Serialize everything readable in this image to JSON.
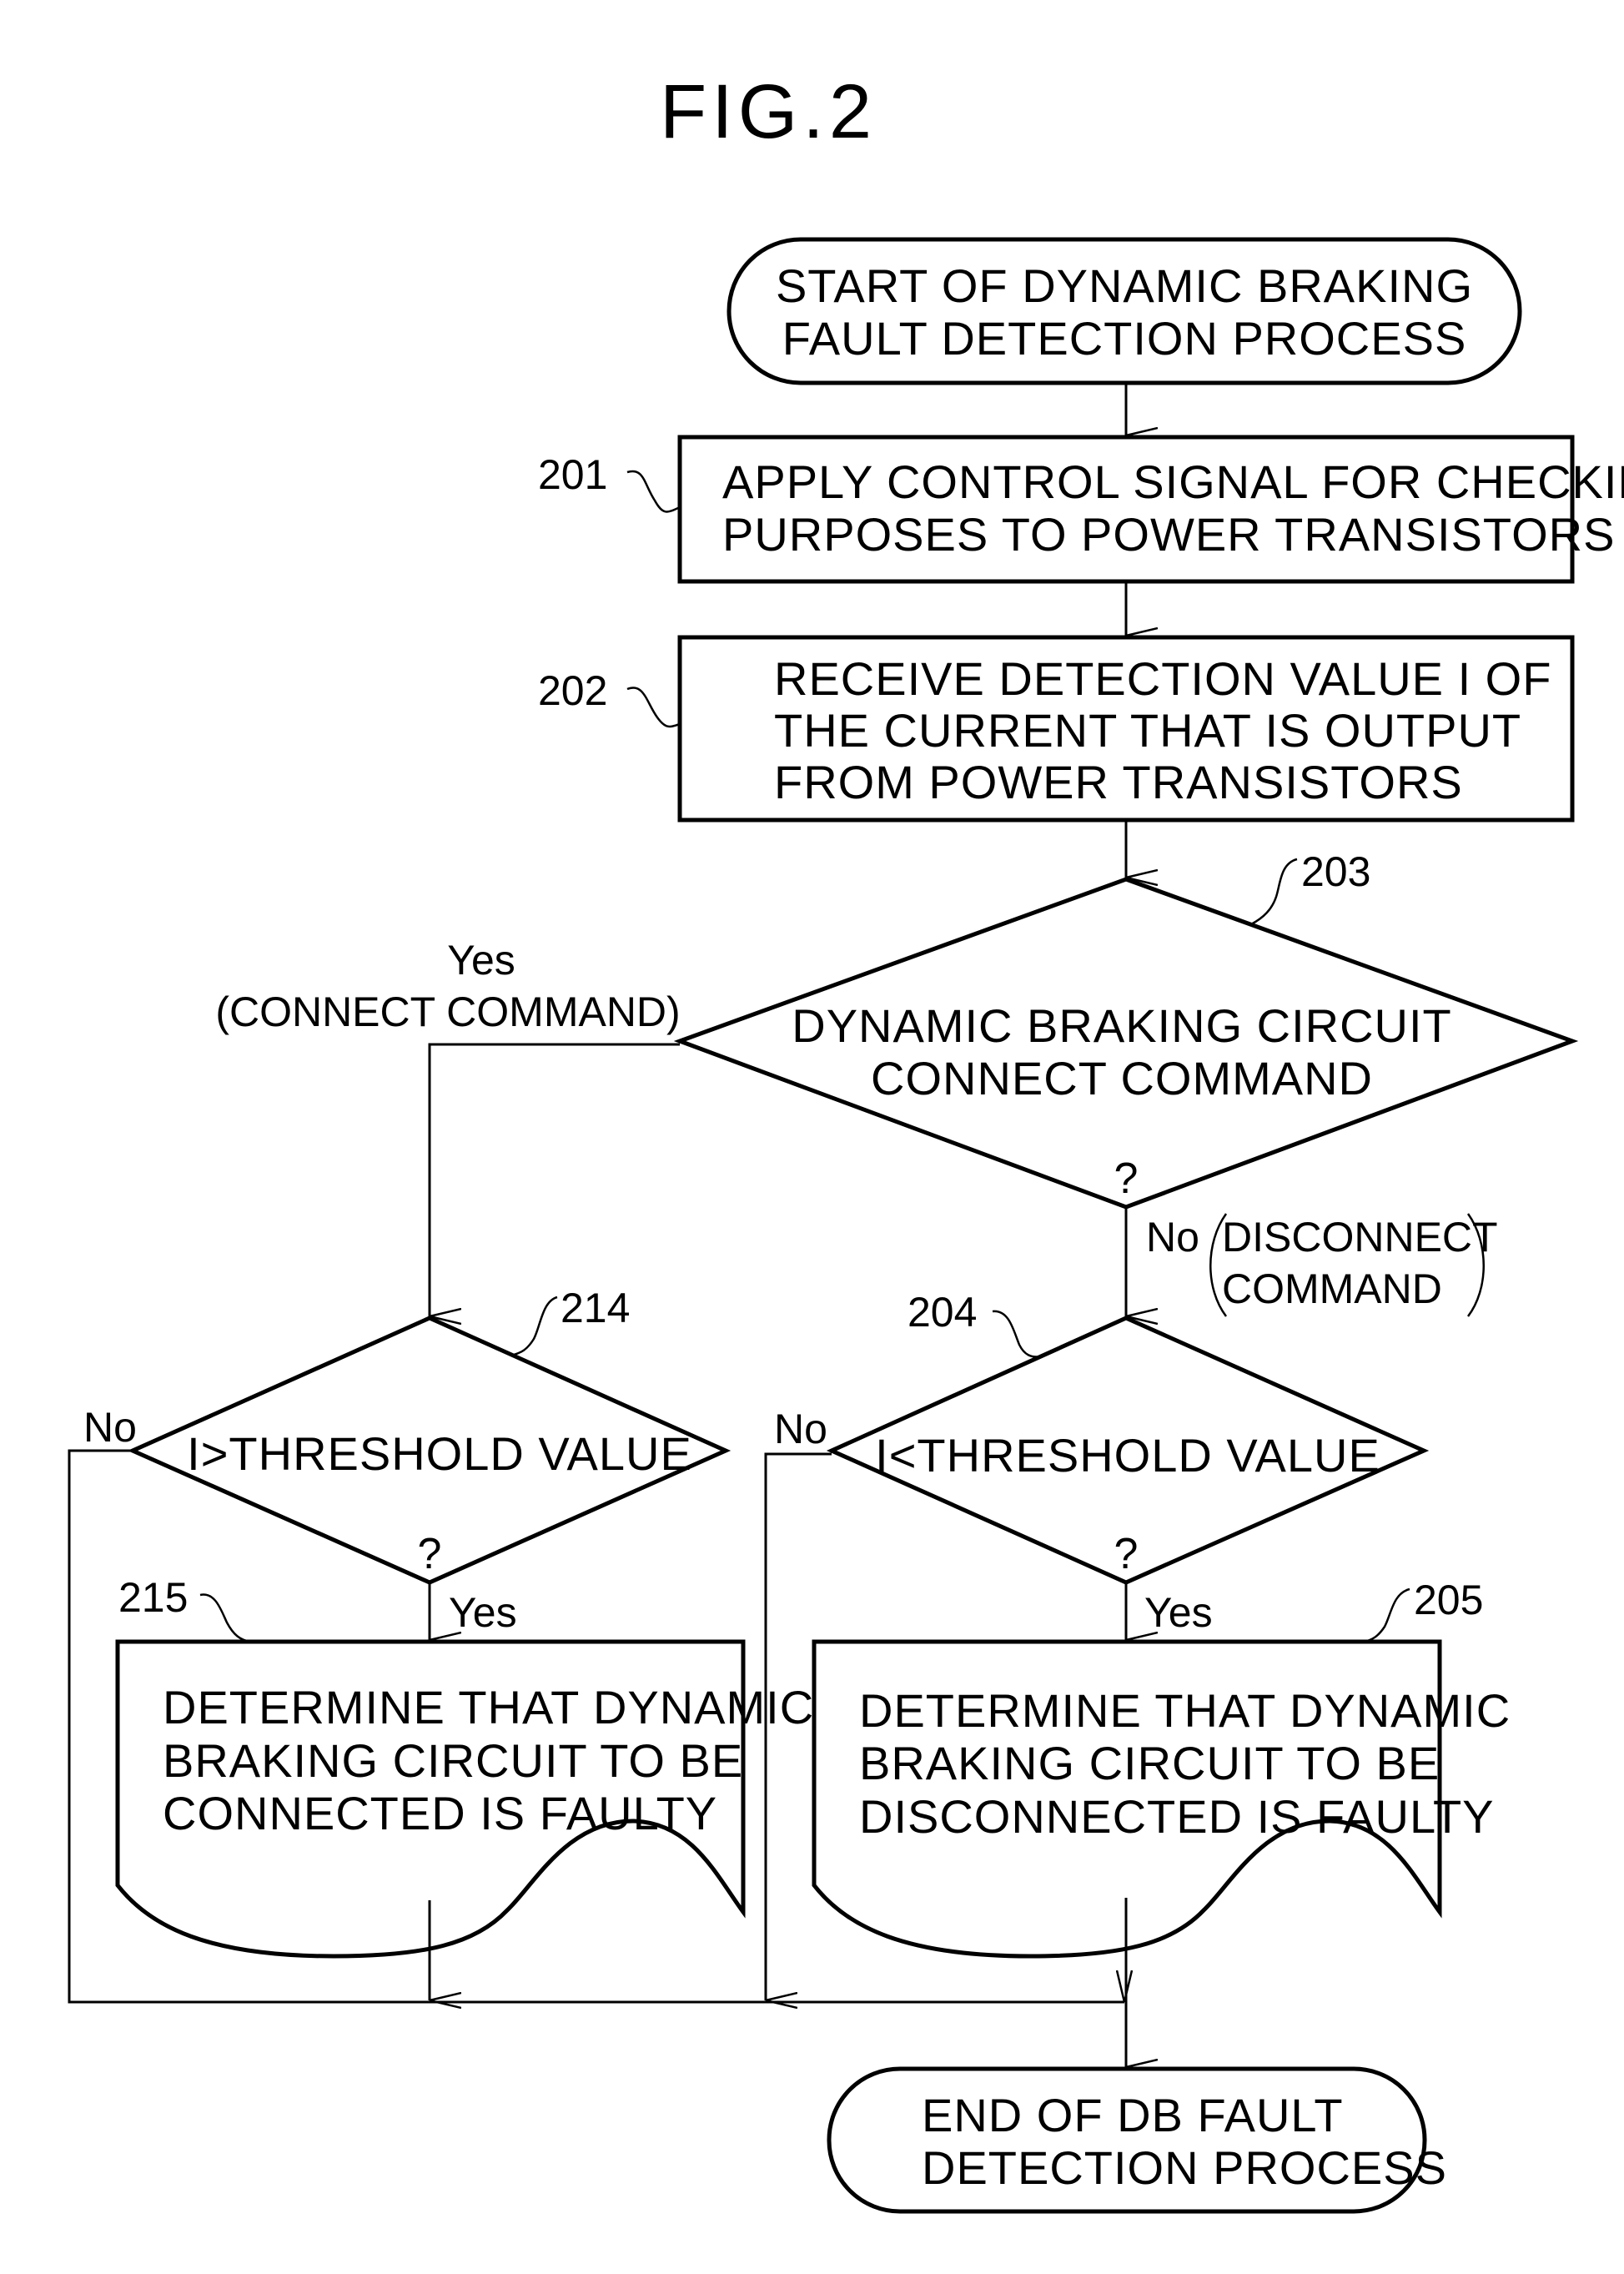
{
  "figure": {
    "title": "FIG.2"
  },
  "nodes": {
    "start": {
      "lines": [
        "START OF DYNAMIC BRAKING",
        "FAULT DETECTION PROCESS"
      ]
    },
    "step_201": {
      "ref": "201",
      "lines": [
        "APPLY CONTROL SIGNAL FOR CHECKING",
        "PURPOSES TO POWER TRANSISTORS"
      ]
    },
    "step_202": {
      "ref": "202",
      "lines": [
        "RECEIVE DETECTION VALUE I OF",
        "THE CURRENT THAT IS OUTPUT",
        "FROM POWER TRANSISTORS"
      ]
    },
    "decision_203": {
      "ref": "203",
      "lines": [
        "DYNAMIC BRAKING CIRCUIT",
        "CONNECT COMMAND"
      ],
      "question": "?"
    },
    "decision_214": {
      "ref": "214",
      "text": "I>THRESHOLD VALUE",
      "question": "?"
    },
    "decision_204": {
      "ref": "204",
      "text": "I<THRESHOLD VALUE",
      "question": "?"
    },
    "result_215": {
      "ref": "215",
      "lines": [
        "DETERMINE THAT DYNAMIC",
        "BRAKING CIRCUIT TO BE",
        "CONNECTED IS FAULTY"
      ]
    },
    "result_205": {
      "ref": "205",
      "lines": [
        "DETERMINE THAT DYNAMIC",
        "BRAKING CIRCUIT TO BE",
        "DISCONNECTED IS FAULTY"
      ]
    },
    "end": {
      "lines": [
        "END OF DB FAULT",
        "DETECTION PROCESS"
      ]
    }
  },
  "edge_labels": {
    "d203_yes": "Yes",
    "d203_yes_note": "(CONNECT COMMAND)",
    "d203_no": "No",
    "d203_no_note": [
      "DISCONNECT",
      "COMMAND"
    ],
    "d214_no": "No",
    "d214_yes": "Yes",
    "d204_no": "No",
    "d204_yes": "Yes"
  }
}
